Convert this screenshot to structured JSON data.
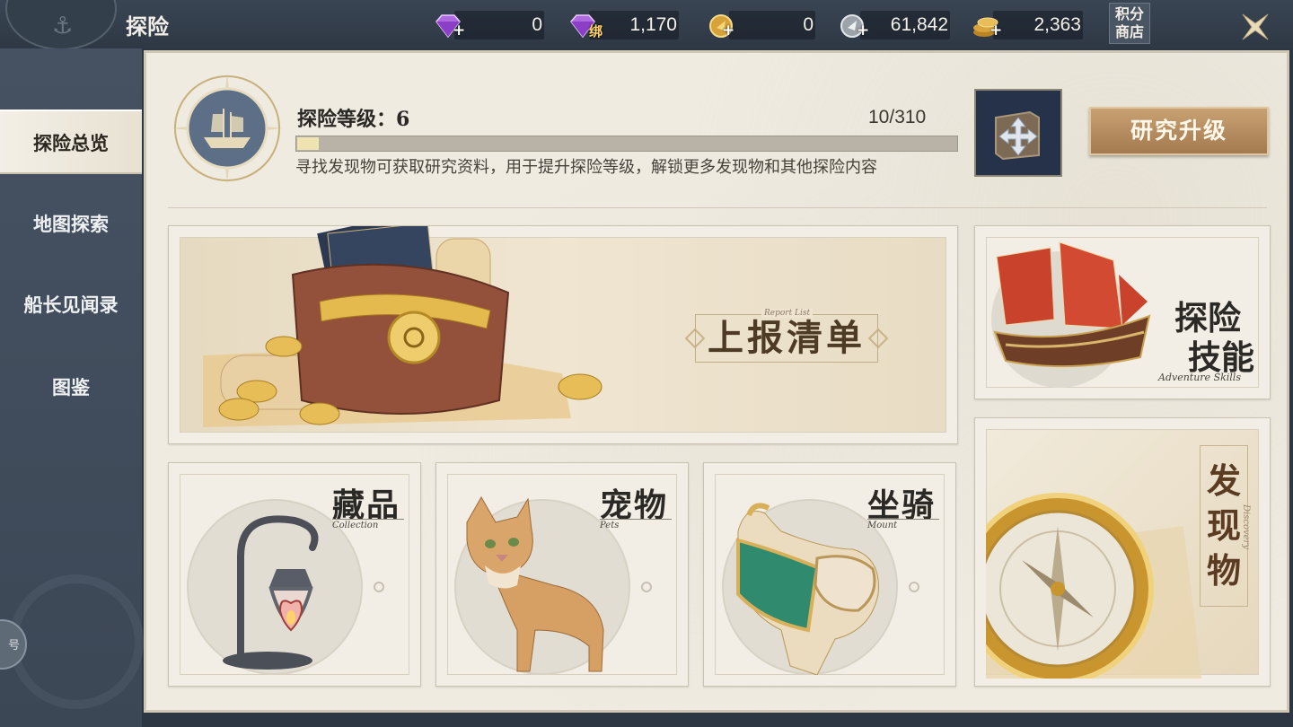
{
  "header": {
    "title": "探险",
    "currencies": [
      {
        "name": "diamond",
        "value": "0"
      },
      {
        "name": "bound-diamond",
        "value": "1,170",
        "tag": "绑"
      },
      {
        "name": "gold-coin",
        "value": "0"
      },
      {
        "name": "silver-coin",
        "value": "61,842"
      },
      {
        "name": "coin-stack",
        "value": "2,363"
      }
    ],
    "shop_label_line1": "积分",
    "shop_label_line2": "商店",
    "plus": "+"
  },
  "sidebar": {
    "items": [
      {
        "label": "探险总览",
        "active": true
      },
      {
        "label": "地图探索"
      },
      {
        "label": "船长见闻录"
      },
      {
        "label": "图鉴"
      }
    ],
    "dial_text": "号"
  },
  "overview": {
    "level_label": "探险等级：6",
    "progress_text": "10/310",
    "progress": {
      "current": 10,
      "max": 310
    },
    "description": "寻找发现物可获取研究资料，用于提升探险等级，解锁更多发现物和其他探险内容",
    "upgrade_button": "研究升级"
  },
  "cards": {
    "report": {
      "title": "上报清单",
      "subtitle": "Report List"
    },
    "skills": {
      "title_line1": "探险",
      "title_line2": "技能",
      "subtitle": "Adventure Skills"
    },
    "discovery": {
      "title": "发现物",
      "subtitle": "Discovery"
    },
    "collection": {
      "title": "藏品",
      "subtitle": "Collection"
    },
    "pets": {
      "title": "宠物",
      "subtitle": "Pets"
    },
    "mount": {
      "title": "坐骑",
      "subtitle": "Mount"
    }
  },
  "colors": {
    "panel": "#efebe1",
    "sidebar": "#465262",
    "topbar": "#3a4553",
    "upgrade_button": "#b48a5c",
    "text_dark": "#2a2824"
  },
  "icons": [
    "anchor-icon",
    "diamond-icon",
    "gold-coin-icon",
    "silver-coin-icon",
    "coin-stack-icon",
    "close-icon",
    "ship-emblem-icon",
    "move-arrows-icon"
  ]
}
